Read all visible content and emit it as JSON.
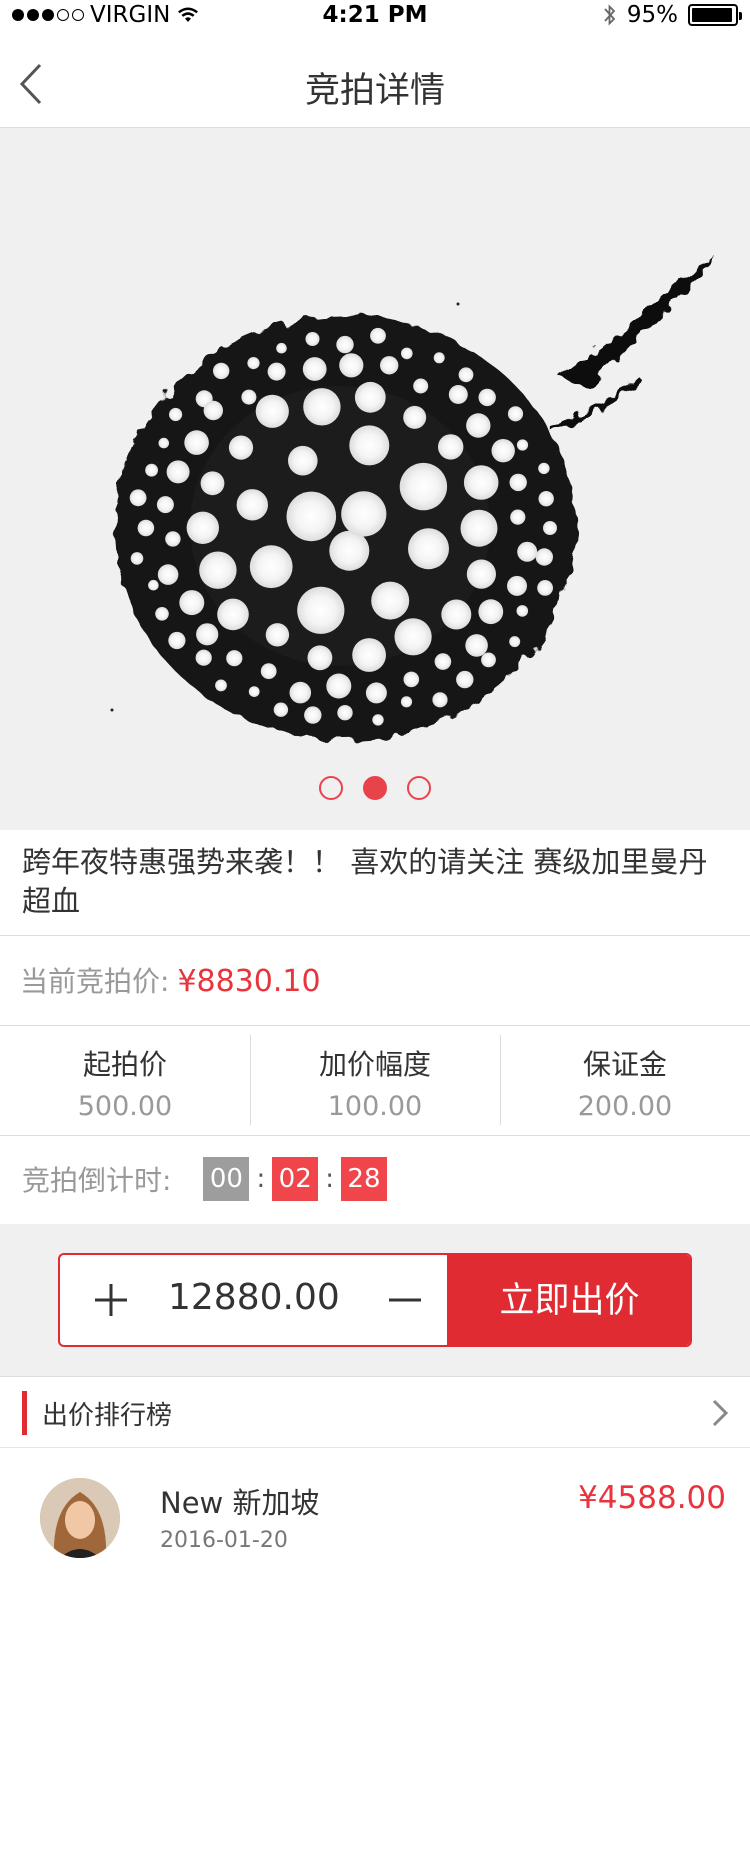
{
  "status_bar": {
    "carrier": "VIRGIN",
    "time": "4:21 PM",
    "battery": "95%",
    "battery_level": 0.95
  },
  "nav": {
    "title": "竞拍详情"
  },
  "hero": {
    "page_count": 3,
    "active_page": 1
  },
  "item": {
    "title": "跨年夜特惠强势来袭！！ 喜欢的请关注 赛级加里曼丹超血"
  },
  "current_price": {
    "label": "当前竞拍价:",
    "value": "¥8830.10"
  },
  "stats": [
    {
      "label": "起拍价",
      "value": "500.00"
    },
    {
      "label": "加价幅度",
      "value": "100.00"
    },
    {
      "label": "保证金",
      "value": "200.00"
    }
  ],
  "countdown": {
    "label": "竞拍倒计时:",
    "hours": "00",
    "minutes": "02",
    "seconds": "28",
    "sep": ":"
  },
  "bid": {
    "value": "12880.00",
    "submit_label": "立即出价"
  },
  "ranking": {
    "title": "出价排行榜",
    "entries": [
      {
        "name": "New 新加坡",
        "date": "2016-01-20",
        "amount": "¥4588.00"
      }
    ]
  },
  "colors": {
    "accent": "#e02b32",
    "price": "#e8343d",
    "pager": "#e8434a",
    "background": "#f1f0f0"
  }
}
